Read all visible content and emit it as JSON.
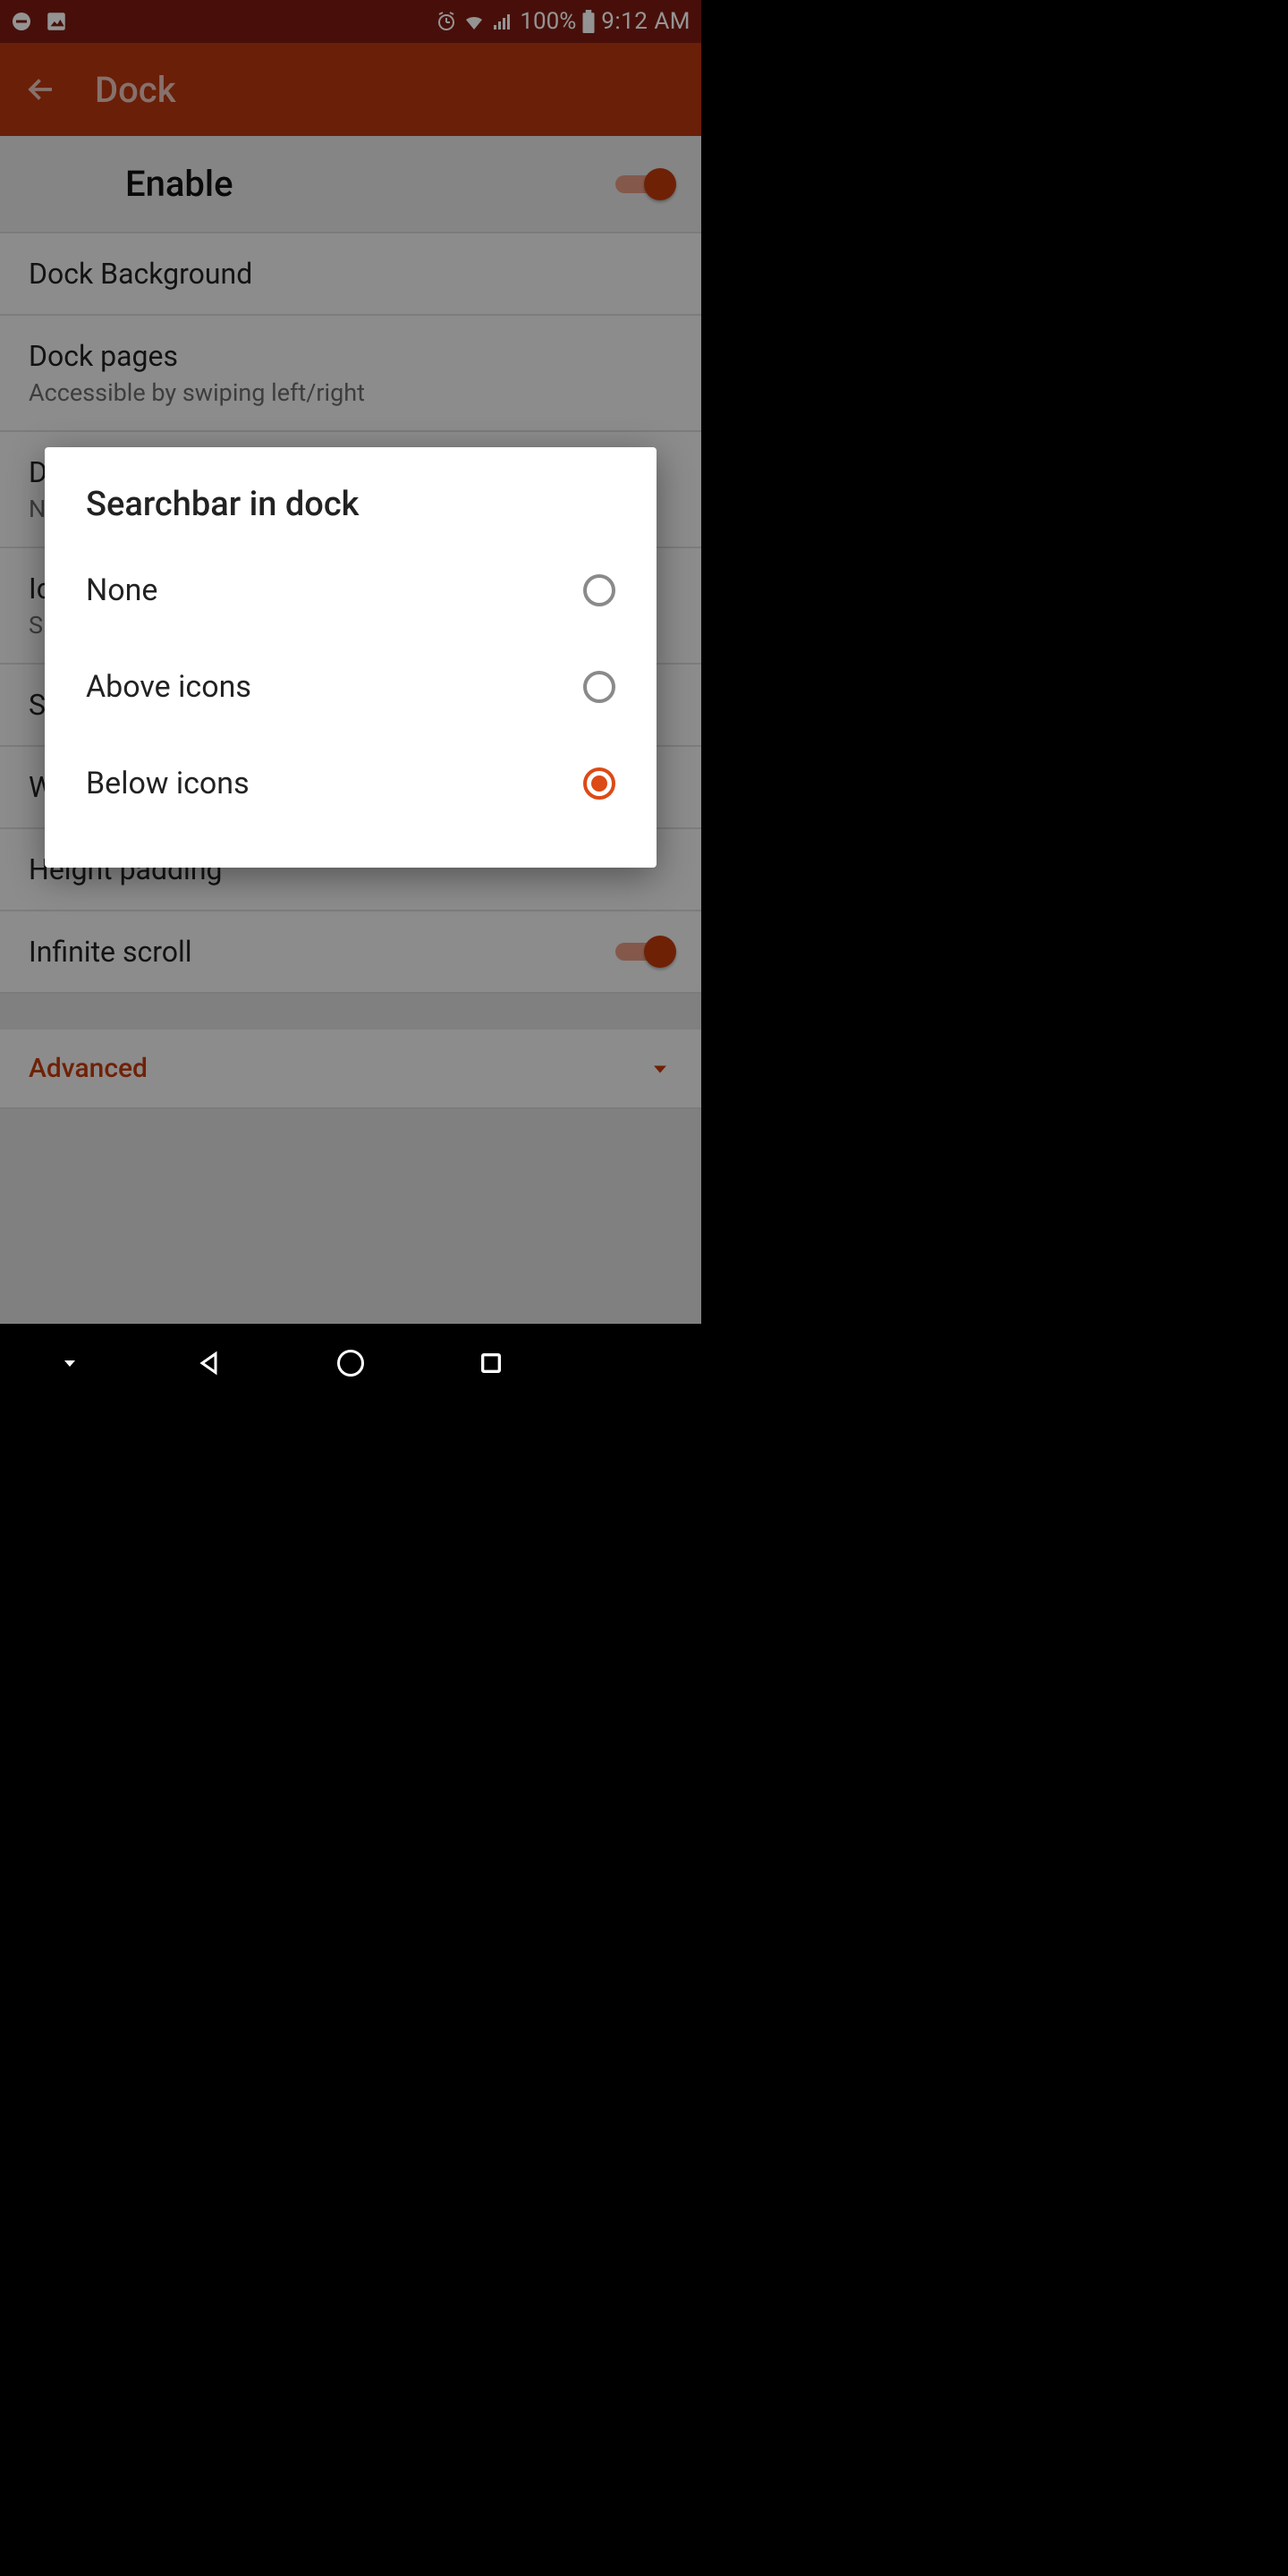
{
  "statusbar": {
    "battery_pct": "100%",
    "time": "9:12 AM"
  },
  "appbar": {
    "title": "Dock"
  },
  "settings": {
    "enable": {
      "label": "Enable",
      "on": true
    },
    "dock_background": {
      "label": "Dock Background"
    },
    "dock_pages": {
      "label": "Dock pages",
      "sub": "Accessible by swiping left/right"
    },
    "dock_searchbar": {
      "label_prefix": "D",
      "sub_prefix": "N"
    },
    "icons": {
      "label_prefix": "Ic",
      "sub_prefix": "Si"
    },
    "s_row": {
      "label_prefix": "S"
    },
    "w_row": {
      "label_prefix": "W"
    },
    "height_padding": {
      "label": "Height padding"
    },
    "infinite_scroll": {
      "label": "Infinite scroll",
      "on": true
    },
    "advanced": {
      "label": "Advanced"
    }
  },
  "dialog": {
    "title": "Searchbar in dock",
    "options": [
      {
        "label": "None",
        "selected": false
      },
      {
        "label": "Above icons",
        "selected": false
      },
      {
        "label": "Below icons",
        "selected": true
      }
    ]
  }
}
